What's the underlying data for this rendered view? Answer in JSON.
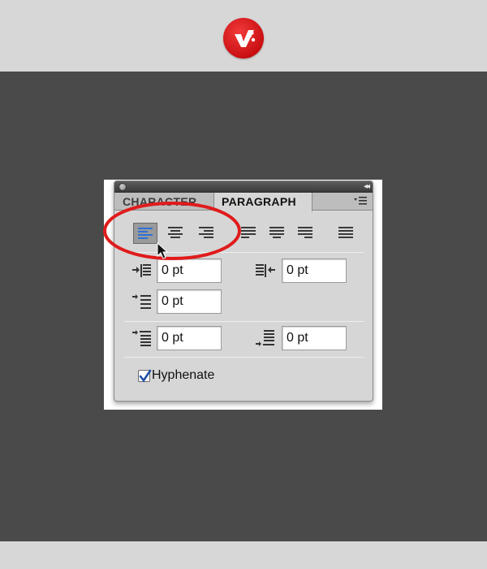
{
  "brand": {
    "logo_icon": "brand-logo-icon",
    "accent": "#d0171a"
  },
  "panel": {
    "tabs": [
      {
        "label": "CHARACTER",
        "active": false
      },
      {
        "label": "PARAGRAPH",
        "active": true
      }
    ],
    "titlebar_buttons": {
      "close_icon": "close-icon",
      "collapse_icon": "double-chevron-icon",
      "menu_icon": "panel-menu-icon"
    },
    "alignment_buttons": [
      {
        "name": "align-left",
        "active": true
      },
      {
        "name": "align-center",
        "active": false
      },
      {
        "name": "align-right",
        "active": false
      },
      {
        "name": "justify-last-left",
        "active": false
      },
      {
        "name": "justify-last-center",
        "active": false
      },
      {
        "name": "justify-last-right",
        "active": false
      },
      {
        "name": "justify-all",
        "active": false
      }
    ],
    "fields": {
      "indent_left": "0 pt",
      "indent_right": "0 pt",
      "indent_first_line": "0 pt",
      "space_before": "0 pt",
      "space_after": "0 pt"
    },
    "hyphenate": {
      "label": "Hyphenate",
      "checked": true
    }
  },
  "annotation": {
    "ring_color": "#e01b1b"
  }
}
